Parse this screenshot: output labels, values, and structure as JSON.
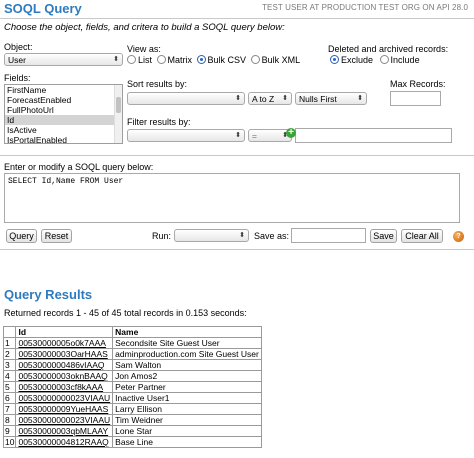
{
  "header": {
    "title": "SOQL Query",
    "user_info": "TEST USER AT PRODUCTION TEST ORG ON API 28.0"
  },
  "instructions": "Choose the object, fields, and critera to build a SOQL query below:",
  "object": {
    "label": "Object:",
    "value": "User"
  },
  "view_as": {
    "label": "View as:",
    "options": [
      "List",
      "Matrix",
      "Bulk CSV",
      "Bulk XML"
    ],
    "selected": "Bulk CSV"
  },
  "deleted": {
    "label": "Deleted and archived records:",
    "options": [
      "Exclude",
      "Include"
    ],
    "selected": "Exclude"
  },
  "fields": {
    "label": "Fields:",
    "items": [
      "FirstName",
      "ForecastEnabled",
      "FullPhotoUrl",
      "Id",
      "IsActive",
      "IsPortalEnabled"
    ],
    "selected": "Id"
  },
  "sort": {
    "label": "Sort results by:",
    "field": "",
    "direction": "A to Z",
    "nulls": "Nulls First"
  },
  "max_records": {
    "label": "Max Records:",
    "value": ""
  },
  "filter": {
    "label": "Filter results by:",
    "field": "",
    "operator": "=",
    "value": ""
  },
  "soql": {
    "label": "Enter or modify a SOQL query below:",
    "value": "SELECT Id,Name FROM User"
  },
  "actions": {
    "query": "Query",
    "reset": "Reset",
    "run_label": "Run:",
    "run_value": "",
    "save_as_label": "Save as:",
    "save_as_value": "",
    "save": "Save",
    "clear_all": "Clear All"
  },
  "results": {
    "title": "Query Results",
    "summary": "Returned records 1 - 45 of 45 total records in 0.153 seconds:",
    "columns": [
      "",
      "Id",
      "Name"
    ],
    "rows": [
      [
        "1",
        "00530000005o0k7AAA",
        "Secondsite Site Guest User"
      ],
      [
        "2",
        "00530000003OarHAAS",
        "adminproduction.com Site Guest User"
      ],
      [
        "3",
        "0053000000486vIAAQ",
        "Sam Walton"
      ],
      [
        "4",
        "00530000003oknBAAQ",
        "Jon Amos2"
      ],
      [
        "5",
        "00530000003cf8kAAA",
        "Peter Partner"
      ],
      [
        "6",
        "00530000000023VIAAU",
        "Inactive User1"
      ],
      [
        "7",
        "00530000009YueHAAS",
        "Larry Ellison"
      ],
      [
        "8",
        "00530000000023VIAAU",
        "Tim Weidner"
      ],
      [
        "9",
        "00530000003qbMLAAY",
        "Lone Star"
      ],
      [
        "10",
        "00530000004812RAAQ",
        "Base Line"
      ]
    ]
  }
}
